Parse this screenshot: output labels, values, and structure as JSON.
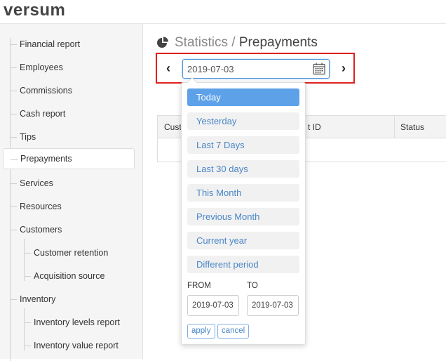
{
  "app": {
    "logo": "versum"
  },
  "sidebar": {
    "items": [
      {
        "label": "Financial report"
      },
      {
        "label": "Employees"
      },
      {
        "label": "Commissions"
      },
      {
        "label": "Cash report"
      },
      {
        "label": "Tips"
      },
      {
        "label": "Prepayments"
      },
      {
        "label": "Services"
      },
      {
        "label": "Resources"
      },
      {
        "label": "Customers"
      },
      {
        "label": "Customer retention"
      },
      {
        "label": "Acquisition source"
      },
      {
        "label": "Inventory"
      },
      {
        "label": "Inventory levels report"
      },
      {
        "label": "Inventory value report"
      }
    ]
  },
  "header": {
    "section": "Statistics",
    "separator": " / ",
    "page": "Prepayments"
  },
  "date_picker": {
    "value": "2019-07-03",
    "prev": "‹",
    "next": "›",
    "options": [
      "Today",
      "Yesterday",
      "Last 7 Days",
      "Last 30 days",
      "This Month",
      "Previous Month",
      "Current year",
      "Different period"
    ],
    "selected": "Today",
    "from_label": "FROM",
    "to_label": "TO",
    "from_value": "2019-07-03",
    "to_value": "2019-07-03",
    "apply": "apply",
    "cancel": "cancel"
  },
  "table": {
    "headers": [
      "Custo",
      "t ID",
      "Status"
    ]
  },
  "colors": {
    "accent": "#5da1e8",
    "highlight_border": "#e02020",
    "link": "#4a86c8"
  }
}
